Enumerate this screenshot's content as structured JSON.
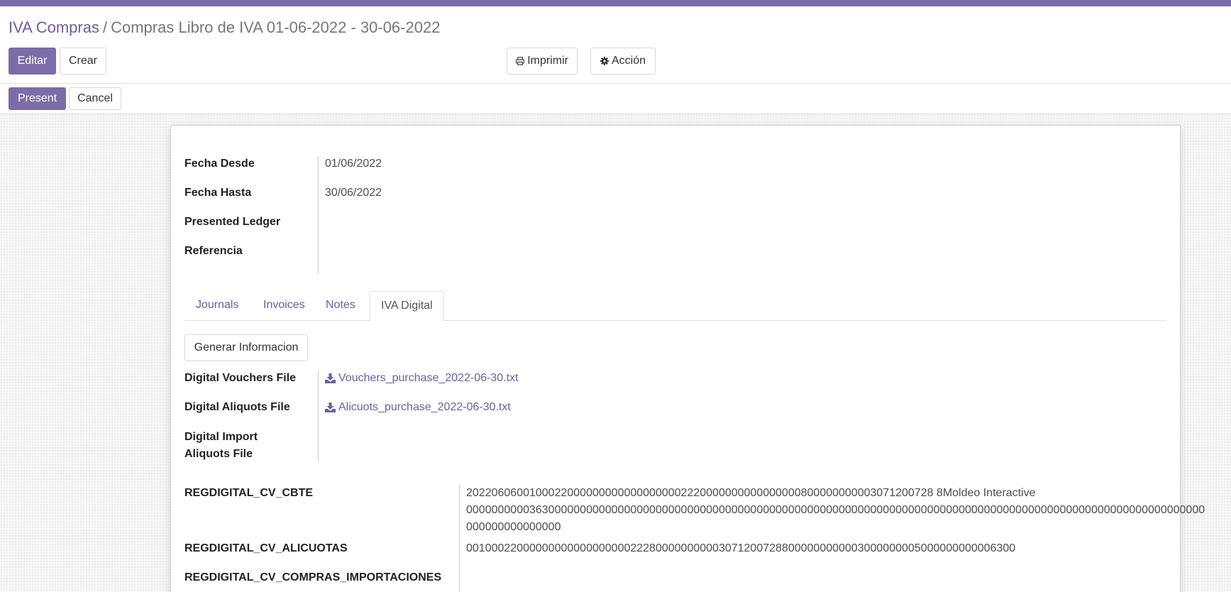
{
  "breadcrumb": {
    "parent": "IVA Compras",
    "separator": "/",
    "current": "Compras Libro de IVA 01-06-2022 - 30-06-2022"
  },
  "buttons": {
    "edit": "Editar",
    "create": "Crear",
    "print": "Imprimir",
    "action": "Acción",
    "print_icon": "printer-icon",
    "action_icon": "gear-icon"
  },
  "statusbar": {
    "present": "Present",
    "cancel": "Cancel"
  },
  "fields": {
    "fecha_desde": {
      "label": "Fecha Desde",
      "value": "01/06/2022"
    },
    "fecha_hasta": {
      "label": "Fecha Hasta",
      "value": "30/06/2022"
    },
    "presented_ledger": {
      "label": "Presented Ledger",
      "value": ""
    },
    "referencia": {
      "label": "Referencia",
      "value": ""
    }
  },
  "tabs": [
    {
      "label": "Journals"
    },
    {
      "label": "Invoices"
    },
    {
      "label": "Notes"
    },
    {
      "label": "IVA Digital",
      "active": true
    }
  ],
  "iva_digital": {
    "generate_button": "Generar Informacion",
    "vouchers_file": {
      "label": "Digital Vouchers File",
      "filename": "Vouchers_purchase_2022-06-30.txt",
      "icon": "download-icon"
    },
    "aliquots_file": {
      "label": "Digital Aliquots File",
      "filename": "Alicuots_purchase_2022-06-30.txt",
      "icon": "download-icon"
    },
    "import_aliquots_file": {
      "label_line1": "Digital Import",
      "label_line2": "Aliquots File",
      "filename": ""
    },
    "regdigital_cv_cbte": {
      "label": "REGDIGITAL_CV_CBTE",
      "line1": "20220606001000220000000000000000002220000000000000000800000000003071200728 8Moldeo Interactive",
      "line2": "000000000036300000000000000000000000000000000000000000000000000000000000000000000000000000000000000000000000000000000",
      "line3": "000000000000000"
    },
    "regdigital_cv_alicuotas": {
      "label": "REGDIGITAL_CV_ALICUOTAS",
      "value": "001000220000000000000000002228000000000030712007288000000000003000000005000000000006300"
    },
    "regdigital_cv_compras_importaciones": {
      "label": "REGDIGITAL_CV_COMPRAS_IMPORTACIONES",
      "value": ""
    }
  },
  "colors": {
    "brand": "#7c6da8",
    "link": "#6c5f9e"
  }
}
